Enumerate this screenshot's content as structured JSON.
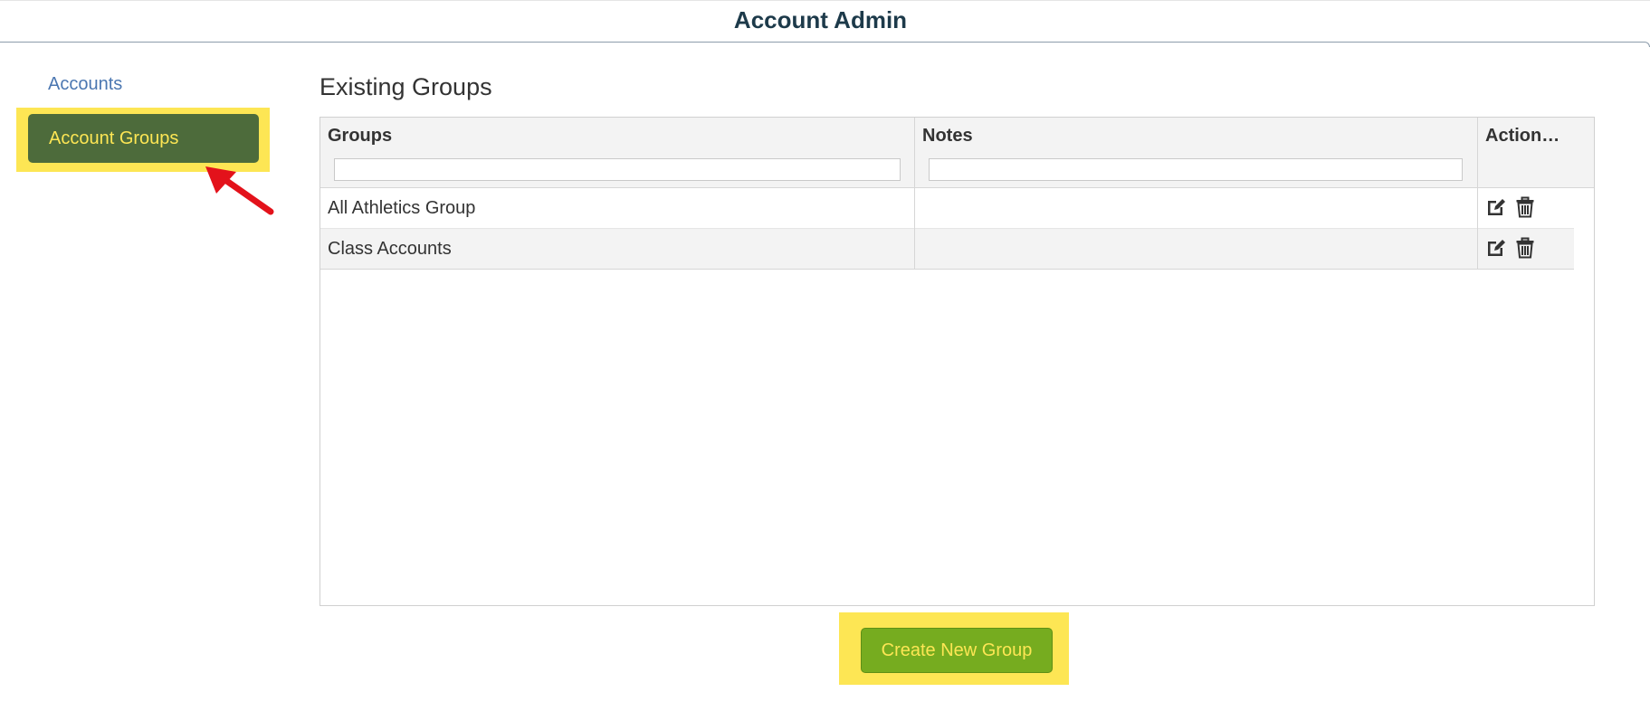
{
  "header": {
    "title": "Account Admin"
  },
  "sidebar": {
    "items": [
      {
        "label": "Accounts",
        "active": false
      },
      {
        "label": "Account Groups",
        "active": true
      }
    ]
  },
  "main": {
    "section_title": "Existing Groups",
    "grid": {
      "columns": [
        "Groups",
        "Notes",
        "Action…"
      ],
      "filters": {
        "groups": {
          "value": "",
          "placeholder": ""
        },
        "notes": {
          "value": "",
          "placeholder": ""
        }
      },
      "rows": [
        {
          "group": "All Athletics Group",
          "notes": ""
        },
        {
          "group": "Class Accounts",
          "notes": ""
        }
      ]
    },
    "create_button_label": "Create New Group"
  },
  "colors": {
    "highlight": "#fde654",
    "active_nav_bg": "#4d6b3b",
    "button_bg": "#76ac1f",
    "link": "#4b77b1",
    "annotation_arrow": "#e3121b"
  },
  "icons": {
    "edit": "edit-icon",
    "delete": "trash-icon",
    "annotation": "red-arrow-icon"
  }
}
